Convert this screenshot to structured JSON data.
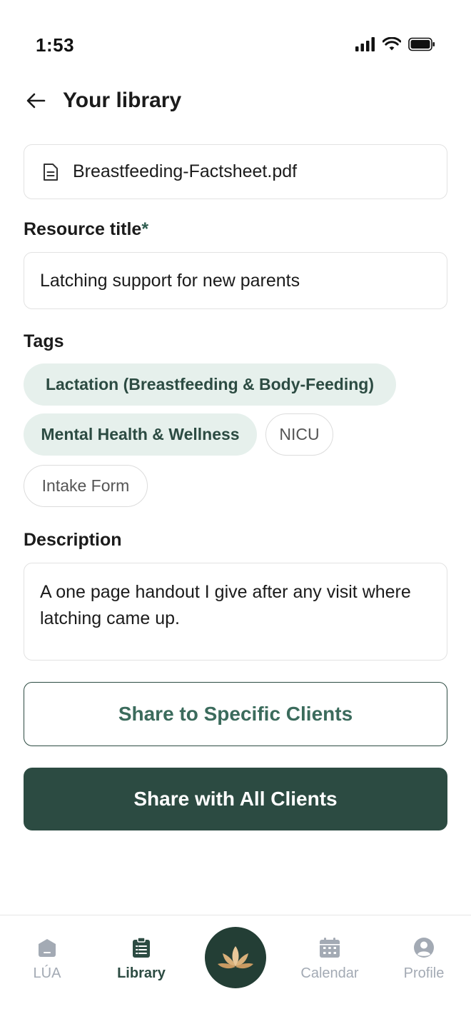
{
  "status_bar": {
    "time": "1:53"
  },
  "header": {
    "title": "Your library"
  },
  "file": {
    "name": "Breastfeeding-Factsheet.pdf",
    "icon": "document-icon"
  },
  "resource_title": {
    "label": "Resource title",
    "required_mark": "*",
    "value": "Latching support for new parents"
  },
  "tags": {
    "label": "Tags",
    "items": [
      {
        "label": "Lactation (Breastfeeding & Body-Feeding)",
        "selected": true
      },
      {
        "label": "Mental Health & Wellness",
        "selected": true
      },
      {
        "label": "NICU",
        "selected": false
      },
      {
        "label": "Intake Form",
        "selected": false
      }
    ]
  },
  "description": {
    "label": "Description",
    "value": "A one page handout I give after any visit where latching came up."
  },
  "actions": {
    "share_specific": "Share to Specific Clients",
    "share_all": "Share with All Clients"
  },
  "tabbar": {
    "items": [
      {
        "label": "LÚA",
        "icon": "home-icon",
        "active": false
      },
      {
        "label": "Library",
        "icon": "clipboard-icon",
        "active": true
      },
      {
        "label": "Calendar",
        "icon": "calendar-icon",
        "active": false
      },
      {
        "label": "Profile",
        "icon": "user-icon",
        "active": false
      }
    ],
    "center_icon": "lotus-icon"
  },
  "colors": {
    "primary": "#2c4b42",
    "primary_light": "#e6f0ec",
    "tab_inactive": "#a3aab4"
  }
}
